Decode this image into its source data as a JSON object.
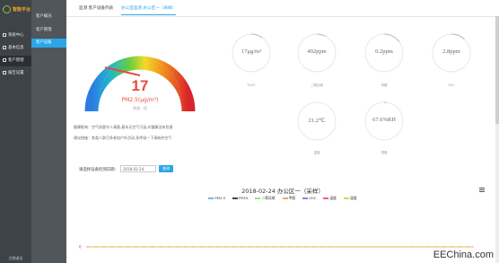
{
  "sidebar": {
    "logo": "智能平台",
    "items": [
      {
        "label": "系统中心",
        "icon": "monitor-icon"
      },
      {
        "label": "基本信息",
        "icon": "info-icon"
      },
      {
        "label": "客户管理",
        "icon": "user-icon"
      },
      {
        "label": "报告设置",
        "icon": "settings-icon"
      }
    ],
    "active_index": 2,
    "footer": "注销退出"
  },
  "submenu": {
    "items": [
      "客户概况",
      "客户管理",
      "客户设备"
    ],
    "active_index": 2
  },
  "tabs": [
    "监测 客户设备列表",
    "办公室监测 办公区一（采样）"
  ],
  "active_tab": 1,
  "gauge": {
    "value": "17",
    "unit": "PM2.5(μg/m³)",
    "status": "状态：优",
    "level": 0.17,
    "marker_left": "优",
    "marker_right": "严重"
  },
  "advice": [
    "健康影响：空气质量令人满意,基本无空气污染,对健康没有危害",
    "建议措施：各类人群可多参加户外活动,多呼吸一下清新的空气"
  ],
  "date_query": {
    "label": "请选择设备检测日期：",
    "value": "2018-02-24",
    "button": "查询"
  },
  "metrics": [
    {
      "value": "17μg/m³",
      "label": "TVOC",
      "level": 0.1
    },
    {
      "value": "492ppm",
      "label": "二氧化碳",
      "level": 0.08
    },
    {
      "value": "0.2ppm",
      "label": "甲醛",
      "level": 0.15
    },
    {
      "value": "2.8ppm",
      "label": "VOC",
      "level": 0.12
    },
    {
      "value": "21.2℃",
      "label": "温度",
      "level": 0.0
    },
    {
      "value": "67.6%RH",
      "label": "湿度",
      "level": 0.02
    }
  ],
  "chart": {
    "title": "2018-02-24 办公区一（采样）",
    "legend": [
      {
        "name": "PM2.5",
        "color": "#7cb5ec"
      },
      {
        "name": "PM10",
        "color": "#434348"
      },
      {
        "name": "二氧化碳",
        "color": "#90ed7d"
      },
      {
        "name": "甲醛",
        "color": "#f7a35c"
      },
      {
        "name": "VOC",
        "color": "#8085e9"
      },
      {
        "name": "温度",
        "color": "#f15c80"
      },
      {
        "name": "湿度",
        "color": "#e4d354"
      }
    ],
    "y_tick": "0"
  },
  "chart_data": {
    "type": "line",
    "title": "2018-02-24 办公区一（采样）",
    "series_names": [
      "PM2.5",
      "PM10",
      "二氧化碳",
      "甲醛",
      "VOC",
      "温度",
      "湿度"
    ],
    "ylim": [
      0,
      1
    ],
    "values_flat": 0
  },
  "watermark": "EEChina.com"
}
